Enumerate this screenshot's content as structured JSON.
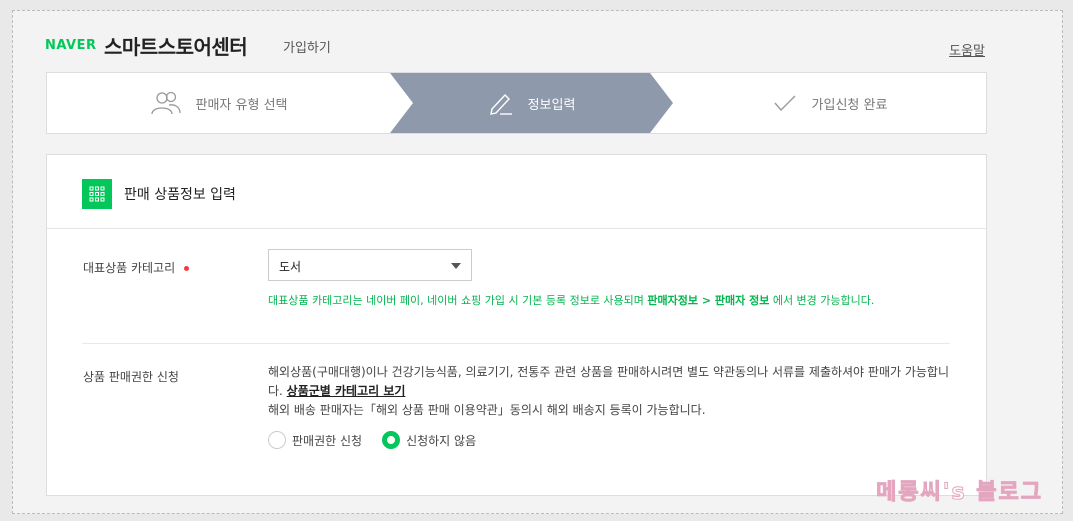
{
  "header": {
    "naver": "NAVER",
    "brand": "스마트스토어센터",
    "subtitle": "가입하기",
    "help": "도움말"
  },
  "steps": [
    {
      "label": "판매자 유형 선택",
      "icon": "users-icon"
    },
    {
      "label": "정보입력",
      "icon": "pencil-icon"
    },
    {
      "label": "가입신청 완료",
      "icon": "check-icon"
    }
  ],
  "panel": {
    "title": "판매 상품정보 입력",
    "category": {
      "label": "대표상품 카테고리",
      "value": "도서",
      "hint_pre": "대표상품 카테고리는 네이버 페이, 네이버 쇼핑 가입 시 기본 등록 정보로 사용되며 ",
      "hint_bold": "판매자정보 > 판매자 정보",
      "hint_post": " 에서 변경 가능합니다."
    },
    "permission": {
      "label": "상품 판매권한 신청",
      "desc1": "해외상품(구매대행)이나 건강기능식품, 의료기기, 전통주 관련 상품을 판매하시려면 별도 약관동의나 서류를 제출하셔야 판매가 가능합니다. ",
      "link": "상품군별 카테고리 보기",
      "desc2": "해외 배송 판매자는「해외 상품 판매 이용약관」동의시 해외 배송지 등록이 가능합니다.",
      "options": [
        {
          "label": "판매권한 신청",
          "selected": false
        },
        {
          "label": "신청하지 않음",
          "selected": true
        }
      ]
    }
  },
  "watermark": "메롱씨's 블로그",
  "colors": {
    "accent": "#03c75a",
    "active_step": "#8e99ab",
    "required": "#f03c3c"
  }
}
